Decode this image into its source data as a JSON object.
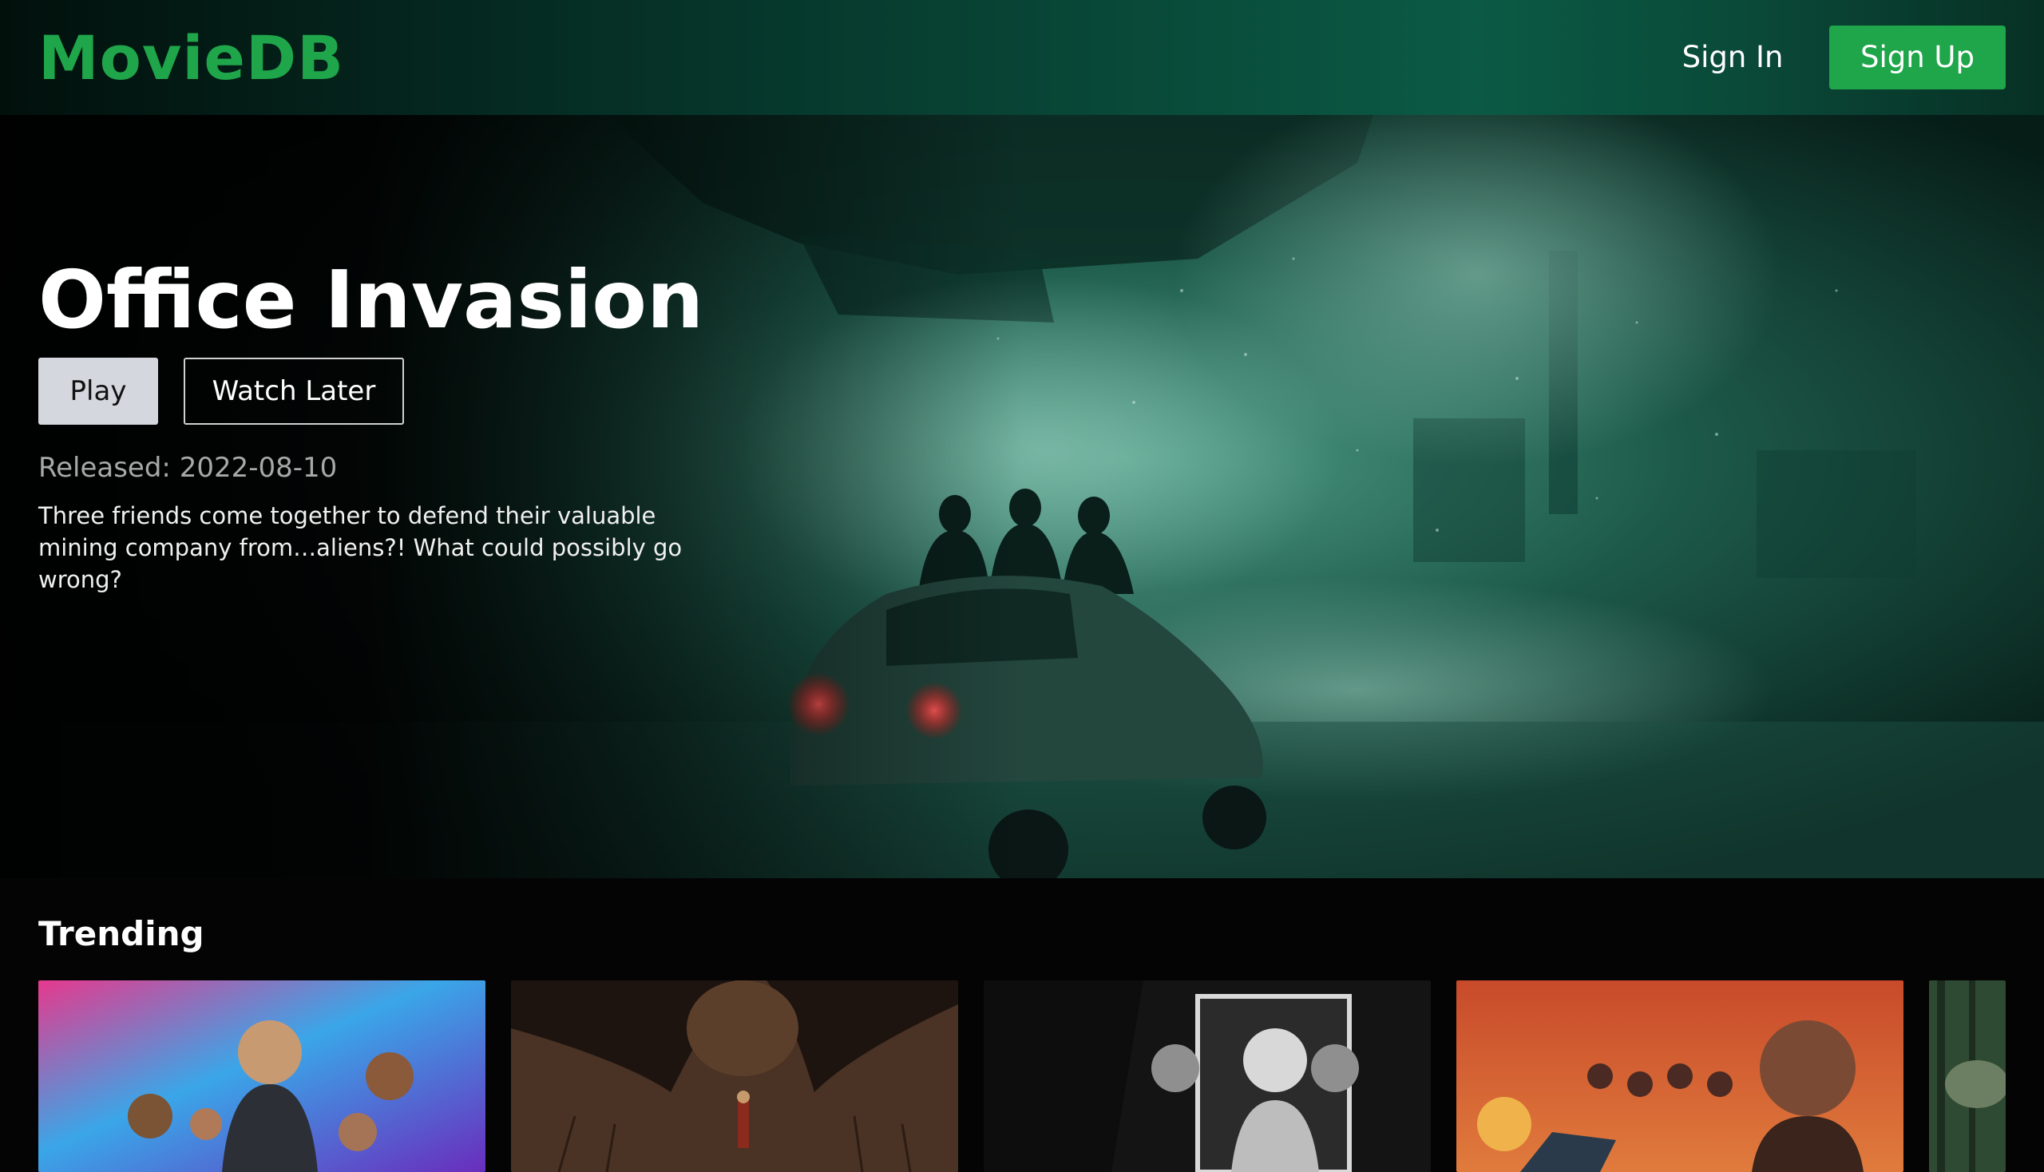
{
  "header": {
    "logo": "MovieDB",
    "sign_in": "Sign In",
    "sign_up": "Sign Up"
  },
  "hero": {
    "title": "Office Invasion",
    "play_label": "Play",
    "watch_later_label": "Watch Later",
    "released": "Released: 2022-08-10",
    "overview": "Three friends come together to defend their valuable mining company from…aliens?! What could possibly go wrong?"
  },
  "trending": {
    "title": "Trending",
    "items": [
      {
        "poster": "bullet-train-poster"
      },
      {
        "poster": "dragon-poster"
      },
      {
        "poster": "blonde-poster"
      },
      {
        "poster": "andor-poster"
      },
      {
        "poster": "forest-poster"
      }
    ]
  },
  "colors": {
    "brand": "#1fa54a",
    "background": "#040404",
    "header_gradient": [
      "#02100c",
      "#0b5a45"
    ]
  }
}
